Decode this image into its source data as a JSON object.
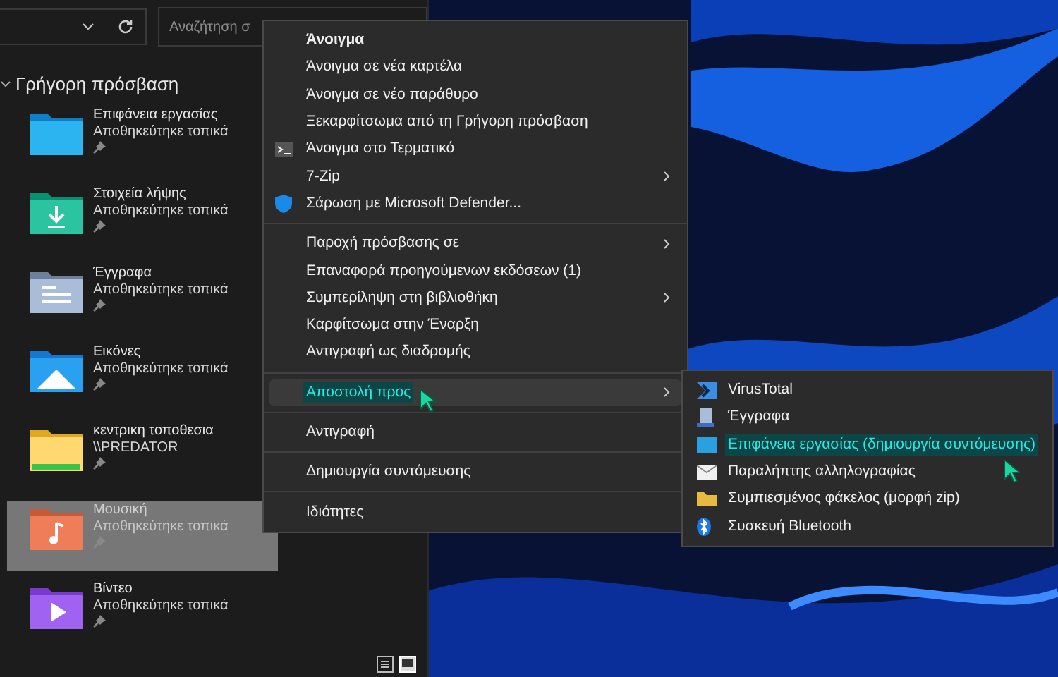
{
  "toolbar": {
    "search_placeholder": "Αναζήτηση σ"
  },
  "sidebar": {
    "header": "Γρήγορη πρόσβαση",
    "expanded": true,
    "items": [
      {
        "kind": "desktop",
        "name": "Επιφάνεια εργασίας",
        "subtitle": "Αποθηκεύτηκε τοπικά",
        "pinned": true,
        "selected": false
      },
      {
        "kind": "downloads",
        "name": "Στοιχεία λήψης",
        "subtitle": "Αποθηκεύτηκε τοπικά",
        "pinned": true,
        "selected": false
      },
      {
        "kind": "documents",
        "name": "Έγγραφα",
        "subtitle": "Αποθηκεύτηκε τοπικά",
        "pinned": true,
        "selected": false
      },
      {
        "kind": "pictures",
        "name": "Εικόνες",
        "subtitle": "Αποθηκεύτηκε τοπικά",
        "pinned": true,
        "selected": false
      },
      {
        "kind": "network",
        "name": "κεντρικη τοποθεσια",
        "subtitle": "\\\\PREDATOR",
        "pinned": true,
        "selected": false
      },
      {
        "kind": "music",
        "name": "Μουσική",
        "subtitle": "Αποθηκεύτηκε τοπικά",
        "pinned": true,
        "selected": true
      },
      {
        "kind": "videos",
        "name": "Βίντεο",
        "subtitle": "Αποθηκεύτηκε τοπικά",
        "pinned": true,
        "selected": false
      }
    ]
  },
  "context_menu": {
    "groups": [
      [
        {
          "label": "Άνοιγμα",
          "default": true,
          "submenu": false,
          "selected": false
        },
        {
          "label": "Άνοιγμα σε νέα καρτέλα",
          "default": false,
          "submenu": false,
          "selected": false
        },
        {
          "label": "Άνοιγμα σε νέο παράθυρο",
          "default": false,
          "submenu": false,
          "selected": false
        },
        {
          "label": "Ξεκαρφίτσωμα από τη Γρήγορη πρόσβαση",
          "default": false,
          "submenu": false,
          "selected": false
        },
        {
          "label": "Άνοιγμα στο Τερματικό",
          "kind": "terminal",
          "default": false,
          "submenu": false,
          "selected": false
        },
        {
          "label": "7-Zip",
          "default": false,
          "submenu": true,
          "selected": false
        },
        {
          "label": "Σάρωση με Microsoft Defender...",
          "kind": "shield",
          "default": false,
          "submenu": false,
          "selected": false
        }
      ],
      [
        {
          "label": "Παροχή πρόσβασης σε",
          "default": false,
          "submenu": true,
          "selected": false
        },
        {
          "label": "Επαναφορά προηγούμενων εκδόσεων (1)",
          "default": false,
          "submenu": false,
          "selected": false
        },
        {
          "label": "Συμπερίληψη στη βιβλιοθήκη",
          "default": false,
          "submenu": true,
          "selected": false
        },
        {
          "label": "Καρφίτσωμα στην Έναρξη",
          "default": false,
          "submenu": false,
          "selected": false
        },
        {
          "label": "Αντιγραφή ως διαδρομής",
          "default": false,
          "submenu": false,
          "selected": false
        }
      ],
      [
        {
          "label": "Αποστολή προς",
          "default": false,
          "submenu": true,
          "selected": true
        }
      ],
      [
        {
          "label": "Αντιγραφή",
          "default": false,
          "submenu": false,
          "selected": false
        }
      ],
      [
        {
          "label": "Δημιουργία συντόμευσης",
          "default": false,
          "submenu": false,
          "selected": false
        }
      ],
      [
        {
          "label": "Ιδιότητες",
          "default": false,
          "submenu": false,
          "selected": false
        }
      ]
    ]
  },
  "send_to_menu": {
    "items": [
      {
        "kind": "virustotal",
        "label": "VirusTotal",
        "selected": false
      },
      {
        "kind": "documents",
        "label": "Έγγραφα",
        "selected": false
      },
      {
        "kind": "desktop",
        "label": "Επιφάνεια εργασίας (δημιουργία συντόμευσης)",
        "selected": true
      },
      {
        "kind": "mail",
        "label": "Παραλήπτης αλληλογραφίας",
        "selected": false
      },
      {
        "kind": "zip",
        "label": "Συμπιεσμένος φάκελος (μορφή zip)",
        "selected": false
      },
      {
        "kind": "bluetooth",
        "label": "Συσκευή Bluetooth",
        "selected": false
      }
    ]
  }
}
